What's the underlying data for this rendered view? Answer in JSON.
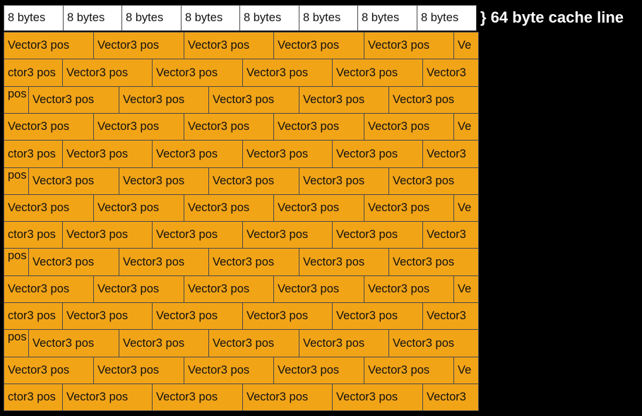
{
  "header": {
    "byte_cells": [
      "8 bytes",
      "8 bytes",
      "8 bytes",
      "8 bytes",
      "8 bytes",
      "8 bytes",
      "8 bytes",
      "8 bytes"
    ],
    "brace": "}",
    "cache_line_label": "64 byte cache line"
  },
  "colors": {
    "background": "#000000",
    "vector_fill": "#f2a417",
    "bytes_fill": "#ffffff",
    "label_text": "#ffffff"
  },
  "rows": [
    [
      "Vector3 pos",
      "Vector3 pos",
      "Vector3 pos",
      "Vector3 pos",
      "Vector3 pos",
      "Ve"
    ],
    [
      "ctor3 pos",
      "Vector3 pos",
      "Vector3 pos",
      "Vector3 pos",
      "Vector3 pos",
      "Vector3"
    ],
    [
      "pos",
      "Vector3 pos",
      "Vector3 pos",
      "Vector3 pos",
      "Vector3 pos",
      "Vector3 pos"
    ],
    [
      "Vector3 pos",
      "Vector3 pos",
      "Vector3 pos",
      "Vector3 pos",
      "Vector3 pos",
      "Ve"
    ],
    [
      "ctor3 pos",
      "Vector3 pos",
      "Vector3 pos",
      "Vector3 pos",
      "Vector3 pos",
      "Vector3"
    ],
    [
      "pos",
      "Vector3 pos",
      "Vector3 pos",
      "Vector3 pos",
      "Vector3 pos",
      "Vector3 pos"
    ],
    [
      "Vector3 pos",
      "Vector3 pos",
      "Vector3 pos",
      "Vector3 pos",
      "Vector3 pos",
      "Ve"
    ],
    [
      "ctor3 pos",
      "Vector3 pos",
      "Vector3 pos",
      "Vector3 pos",
      "Vector3 pos",
      "Vector3"
    ],
    [
      "pos",
      "Vector3 pos",
      "Vector3 pos",
      "Vector3 pos",
      "Vector3 pos",
      "Vector3 pos"
    ],
    [
      "Vector3 pos",
      "Vector3 pos",
      "Vector3 pos",
      "Vector3 pos",
      "Vector3 pos",
      "Ve"
    ],
    [
      "ctor3 pos",
      "Vector3 pos",
      "Vector3 pos",
      "Vector3 pos",
      "Vector3 pos",
      "Vector3"
    ],
    [
      "pos",
      "Vector3 pos",
      "Vector3 pos",
      "Vector3 pos",
      "Vector3 pos",
      "Vector3 pos"
    ],
    [
      "Vector3 pos",
      "Vector3 pos",
      "Vector3 pos",
      "Vector3 pos",
      "Vector3 pos",
      "Ve"
    ],
    [
      "ctor3 pos",
      "Vector3 pos",
      "Vector3 pos",
      "Vector3 pos",
      "Vector3 pos",
      "Vector3"
    ]
  ]
}
